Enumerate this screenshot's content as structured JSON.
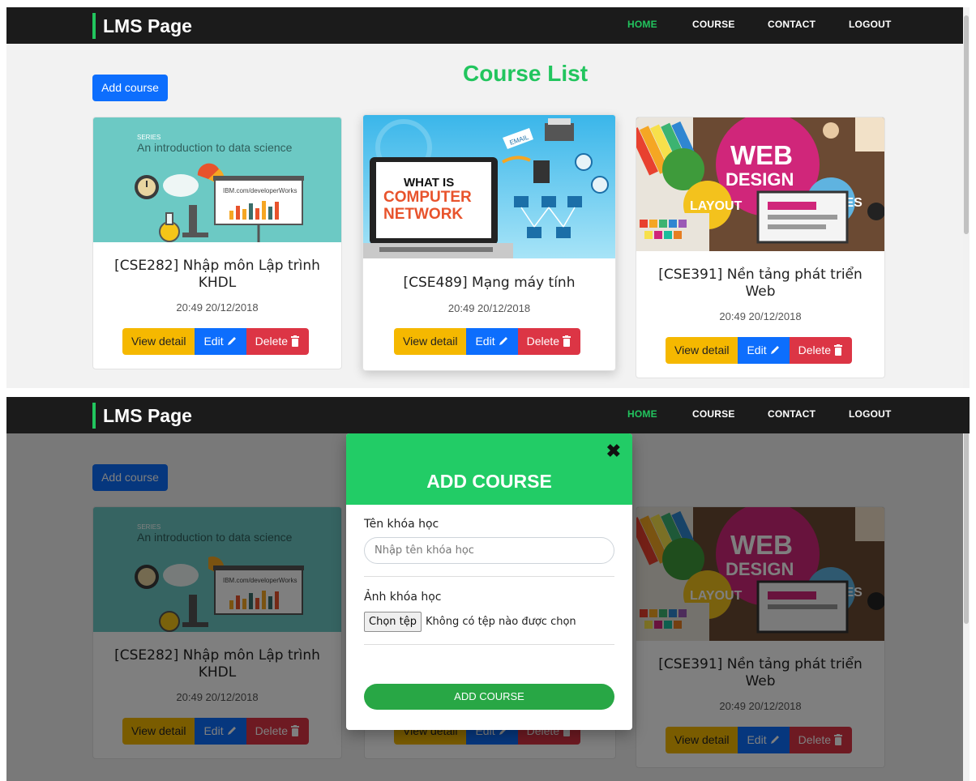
{
  "navbar": {
    "brand": "LMS Page",
    "links": [
      "HOME",
      "COURSE",
      "CONTACT",
      "LOGOUT"
    ]
  },
  "page": {
    "title": "Course List",
    "add_button": "Add course"
  },
  "courses": [
    {
      "title": "[CSE282] Nhập môn Lập trình KHDL",
      "date": "20:49 20/12/2018",
      "image_series": "SERIES",
      "image_caption": "An introduction to data science",
      "image_site": "IBM.com/developerWorks"
    },
    {
      "title": "[CSE489] Mạng máy tính",
      "date": "20:49 20/12/2018",
      "image_caption_1": "WHAT IS",
      "image_caption_2": "COMPUTER",
      "image_caption_3": "NETWORK",
      "image_tag": "EMAIL"
    },
    {
      "title": "[CSE391] Nền tảng phát triển Web",
      "date": "20:49 20/12/2018",
      "image_caption_1": "WEB",
      "image_caption_2": "DESIGN",
      "image_tag_1": "LAYOUT",
      "image_tag_2": "PAGES"
    }
  ],
  "card_buttons": {
    "view": "View detail",
    "edit": "Edit",
    "delete": "Delete"
  },
  "modal": {
    "title": "ADD COURSE",
    "close": "✖",
    "name_label": "Tên khóa học",
    "name_placeholder": "Nhập tên khóa học",
    "image_label": "Ảnh khóa học",
    "file_button": "Chọn tệp",
    "file_status": "Không có tệp nào được chọn",
    "submit": "ADD COURSE"
  },
  "colors": {
    "accent": "#22c55e",
    "navbar": "#1b1b1b",
    "primary": "#0d6efd",
    "warning": "#f5b800",
    "danger": "#dc3545",
    "success": "#28a745"
  }
}
